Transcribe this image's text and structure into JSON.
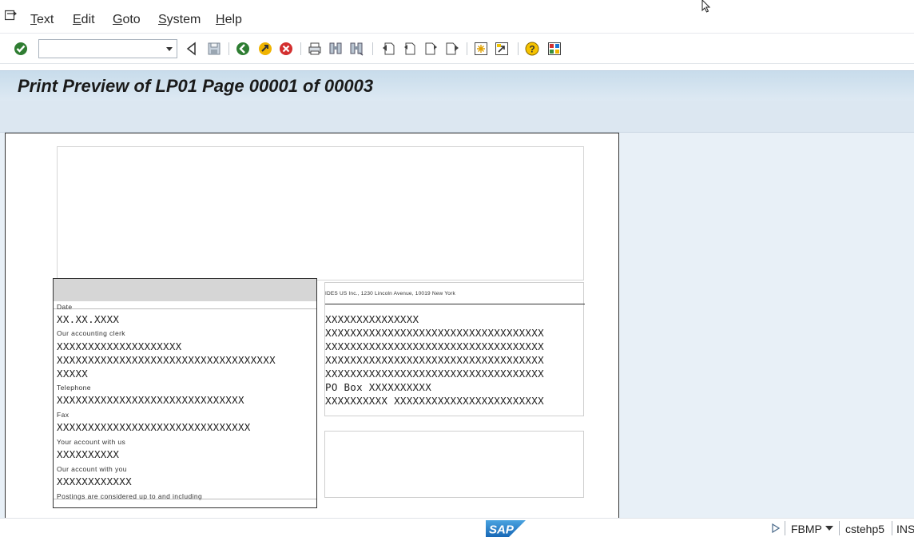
{
  "menu": {
    "items": [
      {
        "label_u": "T",
        "label_rest": "ext"
      },
      {
        "label_u": "E",
        "label_rest": "dit"
      },
      {
        "label_u": "G",
        "label_rest": "oto"
      },
      {
        "label_u": "S",
        "label_rest": "ystem"
      },
      {
        "label_u": "H",
        "label_rest": "elp"
      }
    ]
  },
  "toolbar": {
    "command_field_value": ""
  },
  "title": "Print Preview of LP01 Page 00001 of 00003",
  "document": {
    "sender_line": "IDES US Inc., 1230 Lincoln Avenue, 10019 New York",
    "address_lines": [
      "XXXXXXXXXXXXXXX",
      "XXXXXXXXXXXXXXXXXXXXXXXXXXXXXXXXXXX",
      "XXXXXXXXXXXXXXXXXXXXXXXXXXXXXXXXXXX",
      "XXXXXXXXXXXXXXXXXXXXXXXXXXXXXXXXXXX",
      "XXXXXXXXXXXXXXXXXXXXXXXXXXXXXXXXXXX",
      "PO Box XXXXXXXXXX",
      "XXXXXXXXXX XXXXXXXXXXXXXXXXXXXXXXXX"
    ],
    "info": {
      "date_label": "Date",
      "date_value": "XX.XX.XXXX",
      "clerk_label": "Our accounting clerk",
      "clerk_value_1": "XXXXXXXXXXXXXXXXXXXX",
      "clerk_value_2": "XXXXXXXXXXXXXXXXXXXXXXXXXXXXXXXXXXX",
      "clerk_value_3": "XXXXX",
      "telephone_label": "Telephone",
      "telephone_value": "XXXXXXXXXXXXXXXXXXXXXXXXXXXXXX",
      "fax_label": "Fax",
      "fax_value": "XXXXXXXXXXXXXXXXXXXXXXXXXXXXXXX",
      "your_account_label": "Your account with us",
      "your_account_value": "XXXXXXXXXX",
      "our_account_label": "Our account with you",
      "our_account_value": "XXXXXXXXXXXX",
      "postings_label": "Postings are considered up to and including"
    }
  },
  "status": {
    "logo_text": "SAP",
    "transaction": "FBMP",
    "server": "cstehp5",
    "mode": "INS"
  }
}
